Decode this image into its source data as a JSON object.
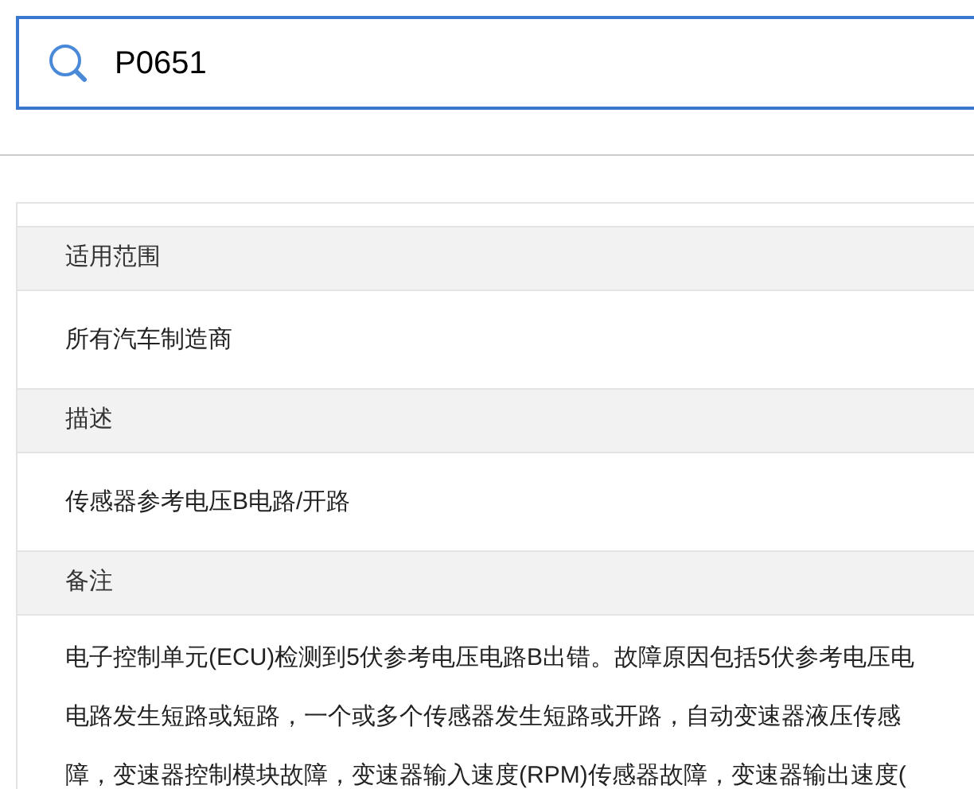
{
  "search": {
    "value": "P0651"
  },
  "sections": [
    {
      "heading": "适用范围",
      "lines": [
        "所有汽车制造商"
      ]
    },
    {
      "heading": "描述",
      "lines": [
        "传感器参考电压B电路/开路"
      ]
    },
    {
      "heading": "备注",
      "lines": [
        "电子控制单元(ECU)检测到5伏参考电压电路B出错。故障原因包括5伏参考电压电",
        "电路发生短路或短路，一个或多个传感器发生短路或开路，自动变速器液压传感",
        "障，变速器控制模块故障，变速器输入速度(RPM)传感器故障，变速器输出速度("
      ]
    }
  ]
}
